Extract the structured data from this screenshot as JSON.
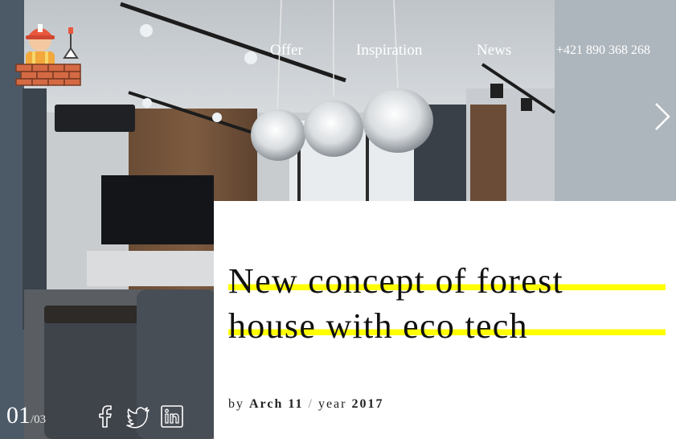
{
  "nav": {
    "items": [
      {
        "label": "Offer"
      },
      {
        "label": "Inspiration"
      },
      {
        "label": "News"
      }
    ],
    "phone": "+421 890 368 268"
  },
  "logo": {
    "icon": "builder-logo-icon"
  },
  "slider": {
    "current": "01",
    "total": "/03",
    "next_icon": "chevron-right-icon"
  },
  "article": {
    "title_line1": "New concept of forest",
    "title_line2": "house with eco tech",
    "by_label": "by",
    "author": "Arch 11",
    "separator": "/",
    "year_label": "year",
    "year": "2017"
  },
  "social": [
    "facebook-icon",
    "twitter-icon",
    "linkedin-icon"
  ],
  "colors": {
    "highlight": "#ffff00",
    "panel": "#ffffff",
    "nav_text": "#ffffff"
  }
}
